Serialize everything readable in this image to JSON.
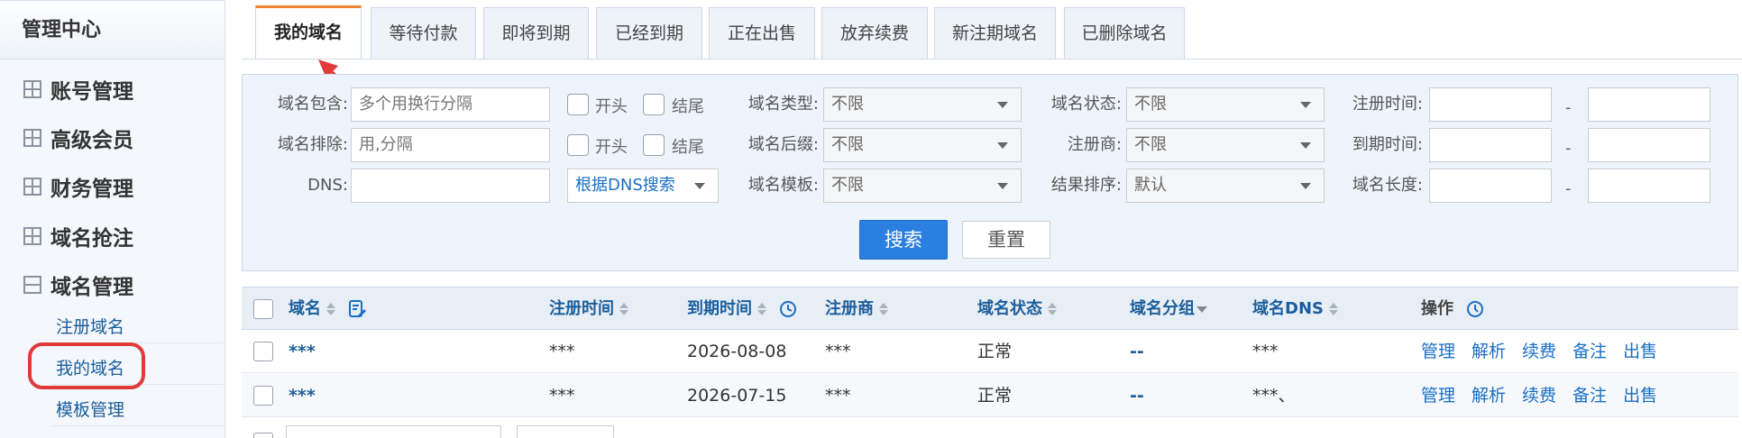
{
  "sidebar": {
    "title": "管理中心",
    "menu": [
      {
        "label": "账号管理",
        "icon": "plus-square-icon"
      },
      {
        "label": "高级会员",
        "icon": "plus-square-icon"
      },
      {
        "label": "财务管理",
        "icon": "plus-square-icon"
      },
      {
        "label": "域名抢注",
        "icon": "plus-square-icon"
      },
      {
        "label": "域名管理",
        "icon": "minus-square-icon"
      }
    ],
    "submenu": [
      "注册域名",
      "我的域名",
      "模板管理"
    ]
  },
  "tabs": [
    "我的域名",
    "等待付款",
    "即将到期",
    "已经到期",
    "正在出售",
    "放弃续费",
    "新注期域名",
    "已删除域名"
  ],
  "active_tab": "我的域名",
  "filter": {
    "row1": {
      "contains_label": "域名包含:",
      "contains_placeholder": "多个用换行分隔",
      "start_label": "开头",
      "end_label": "结尾",
      "type_label": "域名类型:",
      "type_value": "不限",
      "status_label": "域名状态:",
      "status_value": "不限",
      "reg_time_label": "注册时间:"
    },
    "row2": {
      "exclude_label": "域名排除:",
      "exclude_placeholder": "用,分隔",
      "start_label": "开头",
      "end_label": "结尾",
      "suffix_label": "域名后缀:",
      "suffix_value": "不限",
      "registrar_label": "注册商:",
      "registrar_value": "不限",
      "expire_time_label": "到期时间:"
    },
    "row3": {
      "dns_label": "DNS:",
      "dns_search_value": "根据DNS搜索",
      "template_label": "域名模板:",
      "template_value": "不限",
      "sort_label": "结果排序:",
      "sort_value": "默认",
      "length_label": "域名长度:"
    },
    "range_dash": "-",
    "search_button": "搜索",
    "reset_button": "重置"
  },
  "table": {
    "headers": {
      "domain": "域名",
      "reg_time": "注册时间",
      "expire_time": "到期时间",
      "registrar": "注册商",
      "status": "域名状态",
      "group": "域名分组",
      "dns": "域名DNS",
      "actions": "操作"
    },
    "rows": [
      {
        "domain": "***",
        "reg_time": "***",
        "expire_time": "2026-08-08",
        "registrar": "***",
        "status": "正常",
        "group": "--",
        "dns": "***"
      },
      {
        "domain": "***",
        "reg_time": "***",
        "expire_time": "2026-07-15",
        "registrar": "***",
        "status": "正常",
        "group": "--",
        "dns": "***、"
      }
    ],
    "row_actions": [
      "管理",
      "解析",
      "续费",
      "备注",
      "出售"
    ]
  },
  "annotation_color": "#e03a3a",
  "accent_color": "#2a7fe0"
}
